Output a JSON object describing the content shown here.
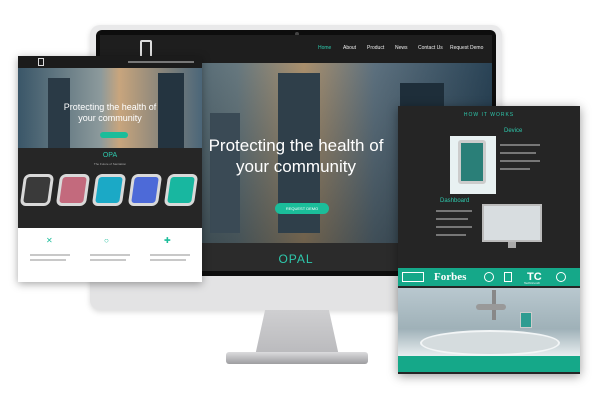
{
  "monitor": {
    "nav": {
      "items": [
        "Home",
        "About",
        "Product",
        "News",
        "Contact Us",
        "Request Demo"
      ],
      "active": "Home"
    },
    "hero": {
      "title_line1": "Protecting the health of",
      "title_line2": "your community",
      "button": "REQUEST DEMO"
    },
    "section_title": "OPAL"
  },
  "tablet": {
    "hero": {
      "title_line1": "Protecting the health of",
      "title_line2": "your community"
    },
    "section_title": "OPA",
    "section_sub": "The Future of Sanitation"
  },
  "phone": {
    "header": "HOW IT WORKS",
    "device_heading": "Device",
    "dashboard_heading": "Dashboard",
    "press": [
      "Forbes",
      "TC"
    ],
    "press_sub": "TechCrunch"
  },
  "colors": {
    "accent": "#2ec8ac",
    "accent_dark": "#15a889",
    "dark_bg": "#2b2b2b"
  },
  "icons": [
    "logo-icon",
    "shield-icon",
    "gear-icon",
    "plus-icon"
  ]
}
